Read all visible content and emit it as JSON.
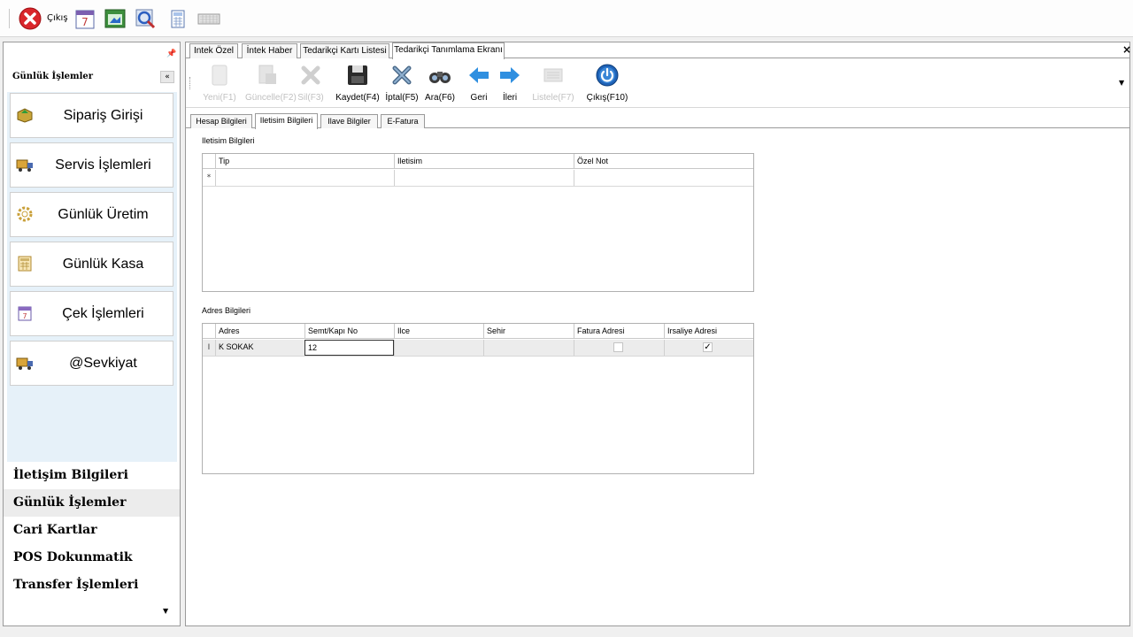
{
  "toolbar": {
    "exit_label": "Çıkış",
    "icons": [
      "exit-icon",
      "calendar-icon",
      "window-icon",
      "search-settings-icon",
      "calculator-icon",
      "keyboard-icon"
    ]
  },
  "sidebar": {
    "title": "Günlük İşlemler",
    "buttons": [
      {
        "label": "Sipariş Girişi",
        "icon": "order-icon"
      },
      {
        "label": "Servis İşlemleri",
        "icon": "truck-icon"
      },
      {
        "label": "Günlük Üretim",
        "icon": "gear-icon"
      },
      {
        "label": "Günlük Kasa",
        "icon": "calculator-icon"
      },
      {
        "label": "Çek İşlemleri",
        "icon": "calendar-icon"
      },
      {
        "label": "@Sevkiyat",
        "icon": "truck-icon"
      }
    ],
    "groups": [
      {
        "label": "İletişim Bilgileri",
        "active": false
      },
      {
        "label": "Günlük İşlemler",
        "active": true
      },
      {
        "label": "Cari Kartlar",
        "active": false
      },
      {
        "label": "POS Dokunmatik",
        "active": false
      },
      {
        "label": "Transfer İşlemleri",
        "active": false
      }
    ]
  },
  "tabs": [
    {
      "label": "Intek Özel",
      "active": false
    },
    {
      "label": "İntek Haber",
      "active": false
    },
    {
      "label": "Tedarikçi Kartı Listesi",
      "active": false
    },
    {
      "label": "Tedarikçi Tanımlama Ekranı",
      "active": true
    }
  ],
  "ribbon": [
    {
      "label": "Yeni(F1)",
      "enabled": false,
      "icon": "new-icon"
    },
    {
      "label": "Güncelle(F2)",
      "enabled": false,
      "icon": "update-icon"
    },
    {
      "label": "Sil(F3)",
      "enabled": false,
      "icon": "delete-icon"
    },
    {
      "label": "Kaydet(F4)",
      "enabled": true,
      "icon": "save-icon"
    },
    {
      "label": "İptal(F5)",
      "enabled": true,
      "icon": "cancel-icon"
    },
    {
      "label": "Ara(F6)",
      "enabled": true,
      "icon": "binoculars-icon"
    },
    {
      "label": "Geri",
      "enabled": true,
      "icon": "arrow-left-icon"
    },
    {
      "label": "İleri",
      "enabled": true,
      "icon": "arrow-right-icon"
    },
    {
      "label": "Listele(F7)",
      "enabled": false,
      "icon": "list-icon"
    },
    {
      "label": "Çıkış(F10)",
      "enabled": true,
      "icon": "power-icon"
    }
  ],
  "subtabs": [
    {
      "label": "Hesap Bilgileri",
      "active": false
    },
    {
      "label": "Iletisim Bilgileri",
      "active": true
    },
    {
      "label": "Ilave Bilgiler",
      "active": false
    },
    {
      "label": "E-Fatura",
      "active": false
    }
  ],
  "contact_grid": {
    "title": "Iletisim Bilgileri",
    "columns": [
      "Tip",
      "Iletisim",
      "Özel Not"
    ],
    "new_row_marker": "*"
  },
  "address_grid": {
    "title": "Adres Bilgileri",
    "columns": [
      "Adres",
      "Semt/Kapı No",
      "Ilce",
      "Sehir",
      "Fatura Adresi",
      "Irsaliye Adresi"
    ],
    "row_marker": "I",
    "rows": [
      {
        "adres": "K SOKAK",
        "semt": "12",
        "ilce": "",
        "sehir": "",
        "fatura": false,
        "irsaliye": true
      }
    ]
  }
}
